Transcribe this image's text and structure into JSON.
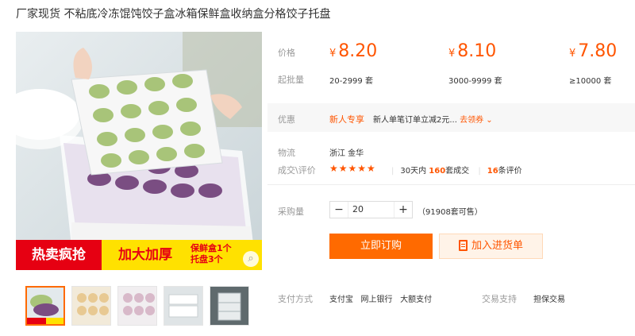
{
  "product": {
    "title": "厂家现货 不粘底冷冻馄饨饺子盒冰箱保鲜盒收纳盒分格饺子托盘"
  },
  "banner": {
    "hot_sale": "热卖疯抢",
    "thicker": "加大加厚",
    "bundle_line1": "保鲜盒1个",
    "bundle_line2": "托盘3个"
  },
  "pricing": {
    "price_label": "价格",
    "moq_label": "起批量",
    "currency": "¥",
    "tiers": [
      {
        "price": "8.20",
        "range": "20-2999 套"
      },
      {
        "price": "8.10",
        "range": "3000-9999 套"
      },
      {
        "price": "7.80",
        "range": "≥10000 套"
      }
    ]
  },
  "promo": {
    "label": "优惠",
    "tag": "新人专享",
    "text": "新人单笔订单立减2元...",
    "link": "去领券 ⌄"
  },
  "logistics": {
    "label": "物流",
    "value": "浙江 金华"
  },
  "trade": {
    "label": "成交\\评价",
    "rating_stars": 5,
    "stars_text": "★★★★★",
    "period": "30天内",
    "sold_count": "160",
    "sold_suffix": "套成交",
    "review_count": "16",
    "review_suffix": "条评价"
  },
  "quantity": {
    "label": "采购量",
    "minus": "−",
    "value": "20",
    "plus": "+",
    "stock": "（91908套可售）"
  },
  "actions": {
    "buy_now": "立即订购",
    "add_to_list": "加入进货单"
  },
  "payment": {
    "label": "支付方式",
    "methods": "支付宝   网上银行   大额支付",
    "support_label": "交易支持",
    "support_value": "担保交易"
  },
  "colors": {
    "accent": "#ff6a00",
    "price": "#ff5500",
    "banner_red": "#e60012",
    "banner_yellow": "#ffe100"
  }
}
